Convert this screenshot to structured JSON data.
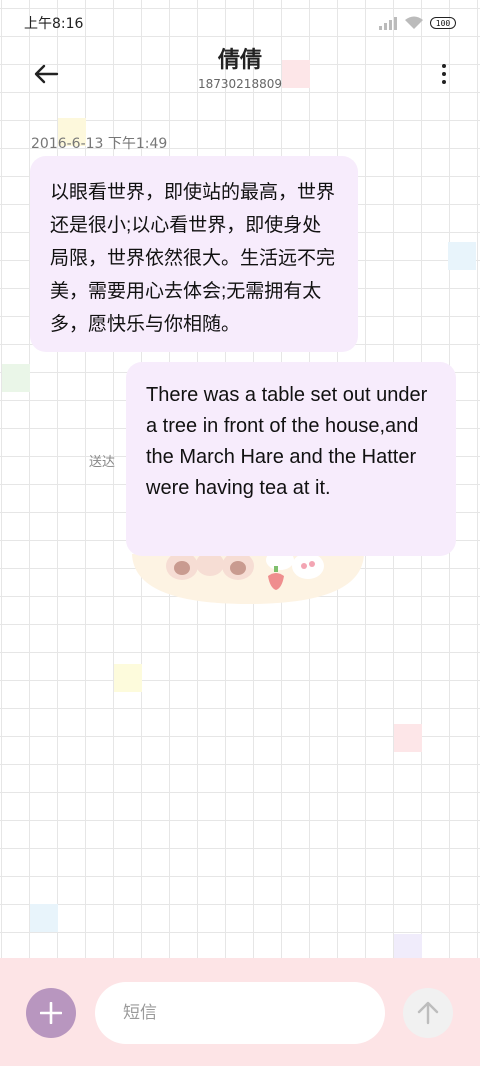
{
  "status_bar": {
    "time": "上午8:16",
    "battery": "100"
  },
  "header": {
    "contact_name": "倩倩",
    "contact_number": "18730218809"
  },
  "conversation": {
    "timestamp": "2016-6-13 下午1:49",
    "messages": [
      {
        "text": "以眼看世界，即使站的最高，世界还是很小;以心看世界，即使身处局限，世界依然很大。生活远不完美，需要用心去体会;无需拥有太多，愿快乐与你相随。"
      },
      {
        "text": "There was a table set out under a tree in front of the house,and the March Hare and the Hatter were having tea at it."
      }
    ],
    "send_status": "送达"
  },
  "composer": {
    "placeholder": "短信"
  },
  "colors": {
    "bubble": "#f7ecfc",
    "composer_bg": "#fde4e6",
    "add_button": "#b896bf"
  },
  "icons": {
    "back": "back-arrow-icon",
    "more": "more-vertical-icon",
    "add": "plus-icon",
    "send": "arrow-up-icon",
    "signal": "signal-icon",
    "wifi": "wifi-icon",
    "battery": "battery-icon"
  }
}
